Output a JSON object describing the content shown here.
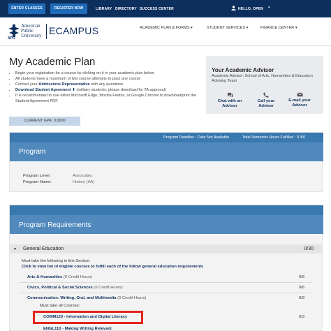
{
  "topbar": {
    "enter_classes": "ENTER CLASSES",
    "register_now": "REGISTER NOW",
    "library": "LIBRARY",
    "directory": "DIRECTORY",
    "success_center": "SUCCESS CENTER",
    "user": "HELLO, OPEN"
  },
  "header": {
    "logo_line1": "American",
    "logo_line2": "Public",
    "logo_line3": "University",
    "logo_mark": "APU",
    "ecampus": "ECAMPUS",
    "nav": [
      "ACADEMIC PLAN & FORMS",
      "STUDENT SERVICES",
      "FINANCE CENTER"
    ]
  },
  "page": {
    "title": "My Academic Plan",
    "bullets": [
      "Begin your registration for a course by clicking on it in your academic plan below",
      "All students have a maximum of two course attempts to pass any course",
      "Contact your ",
      "Admissions Representative",
      " with any questions",
      "Download Student Agreement",
      " (military students: please download for TA approval)",
      "It is recommended to use either Microsoft Edge, Mozilla Firefox, or Google Chrome to download/print the Student Agreement PDF."
    ]
  },
  "advisor": {
    "title": "Your Academic Advisor",
    "subtitle": "Academic Advisor: School of Arts, Humanities & Education Advising Team",
    "chat": "Chat with an Advisor",
    "call": "Call your Advisor",
    "email": "E-mail your Advisor"
  },
  "gpa": "CURRENT GPA: 0.0000",
  "program": {
    "deadline": "Program Deadline : Date Not Available",
    "hours": "Total Semester Hours Fulfilled : 0 /60",
    "title": "Program",
    "level_label": "Program Level:",
    "level_value": "Associates",
    "name_label": "Program Name:",
    "name_value": "History (AA)"
  },
  "requirements": {
    "title": "Program Requirements",
    "section": "General Education",
    "section_count": "0/30",
    "must_take": "Must take the following in this Section:",
    "click_view": "Click to view list of eligible courses to fulfill each of the follow general education requirements",
    "rows": [
      {
        "name": "Arts & Humanities",
        "hours": "(6 Credit Hours)",
        "count": "0/6"
      },
      {
        "name": "Civics, Political & Social Sciences",
        "hours": "(6 Credit Hours)",
        "count": "0/6"
      },
      {
        "name": "Communication: Writing, Oral, and Multimedia",
        "hours": "(9 Credit Hours)",
        "count": "0/9"
      }
    ],
    "must_take_all": "Must take all Courses:",
    "course1": "COMM120 - Information and Digital Literacy",
    "course1_count": "0/3",
    "course2": "ENGL110 - Making Writing Relevant"
  },
  "colors": {
    "navy": "#0d2f5e",
    "accent_blue": "#1f6bb8",
    "panel_blue": "#5189bd",
    "highlight_red": "#e2231a"
  }
}
